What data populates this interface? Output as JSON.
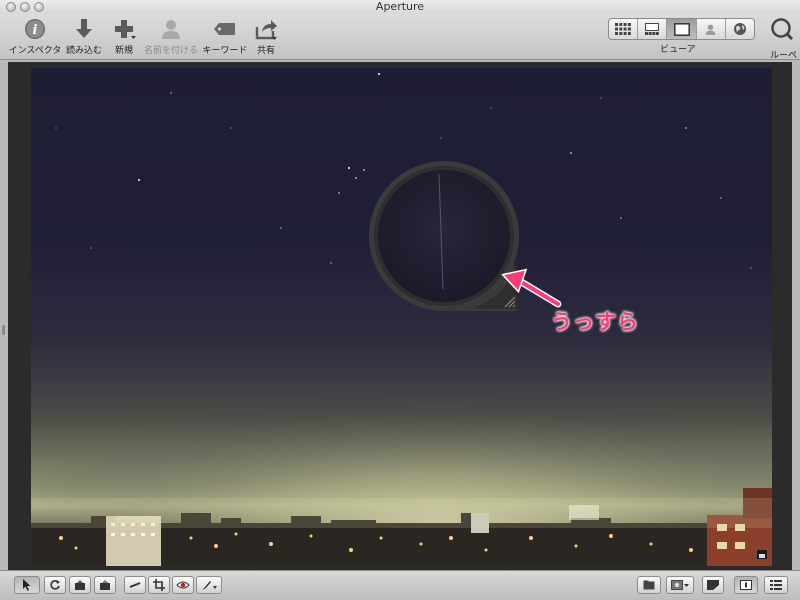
{
  "window": {
    "title": "Aperture"
  },
  "toolbar": {
    "inspector_label": "インスペクタ",
    "import_label": "読み込む",
    "new_label": "新規",
    "name_label": "名前を付ける",
    "keyword_label": "キーワード",
    "share_label": "共有"
  },
  "viewer": {
    "label": "ビューア",
    "modes": [
      "grid-view-icon",
      "filmstrip-view-icon",
      "viewer-only-icon",
      "faces-icon",
      "places-icon"
    ],
    "active_mode_index": 2
  },
  "loupe": {
    "label": "ルーペ"
  },
  "annotation": {
    "text": "うっすら",
    "color": "#ff3a78"
  },
  "colors": {
    "toolbar_bg": "#d2d2d2",
    "stage_bg": "#2b2b2b",
    "sky": "#1d1d33"
  }
}
